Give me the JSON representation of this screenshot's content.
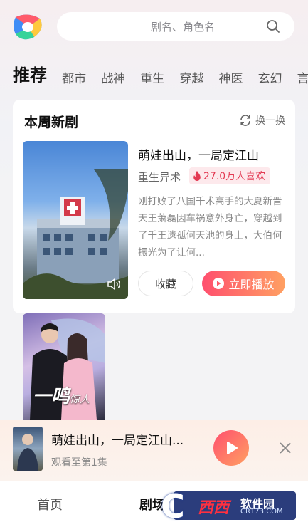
{
  "search": {
    "placeholder": "剧名、角色名"
  },
  "tabs": [
    {
      "label": "推荐",
      "active": true
    },
    {
      "label": "都市"
    },
    {
      "label": "战神"
    },
    {
      "label": "重生"
    },
    {
      "label": "穿越"
    },
    {
      "label": "神医"
    },
    {
      "label": "玄幻"
    },
    {
      "label": "言"
    }
  ],
  "weekly": {
    "title": "本周新剧",
    "refresh_label": "换一换",
    "featured": {
      "title": "萌娃出山，一局定江山",
      "genre": "重生异术",
      "likes": "27.0万人喜欢",
      "description": "刚打败了八国千术高手的大夏新晋天王萧磊因车祸意外身亡，穿越到了千王遗孤何天池的身上，大伯何振光为了让何...",
      "fav_label": "收藏",
      "play_label": "立即播放"
    },
    "second_poster_caption_big": "一鸣",
    "second_poster_caption_small": "惊人"
  },
  "now_playing": {
    "title": "萌娃出山，一局定江山...",
    "subtitle": "观看至第1集"
  },
  "bottom_nav": {
    "home": "首页",
    "theater": "剧场"
  },
  "watermark": {
    "name": "西西",
    "soft": "软件园",
    "url": "CR173.COM",
    "letter": "C"
  },
  "colors": {
    "accent_start": "#ff4f6e",
    "accent_end": "#ffa062",
    "like_red": "#e33a53"
  }
}
